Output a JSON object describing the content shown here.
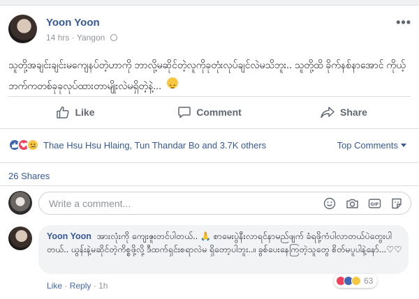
{
  "post": {
    "author": "Yoon Yoon",
    "time": "14 hrs",
    "location": "Yangon",
    "text": "သူတို့အချင်းချင်းမကျေနပ်တဲ့ဟာကို ဘာလို့မဆိုင်တဲ့လူကိုခုတုံးလုပ်ချင်လဲမသိဘူး.. သူတို့ထိ ခိုက်နစ်နာအောင် ကိုယ့်ဘက်ကတစ်ခုခုလုပ်ထားတာမျိုးလဲမရှိတဲ့နဲ့..."
  },
  "actions": {
    "like": "Like",
    "comment": "Comment",
    "share": "Share"
  },
  "reactions": {
    "names": "Thae Hsu Hsu Hlaing, Tun Thandar Bo and 3.7K others",
    "top_comments": "Top Comments"
  },
  "shares": "26 Shares",
  "composer": {
    "placeholder": "Write a comment..."
  },
  "comment": {
    "author": "Yoon Yoon",
    "text": "အားလုံးကို ကျေးဇူးတင်ပါတယ်.. 🙏 စာမေးပွဲနီးလာရင်နာမည်ဖျက် ခံရဖို့ကံပါလာတယ်ပဲတွေးပါတယ်.. ယွန်းနဲ့မဆိုင်တဲ့ကိစ္စဖို့လို့ ဒီထက်ရှင်းစရာလဲမ ရှိတော့ပါဘူး..။ ခွစ်ပေးနေကြတဲ့သူတွေ စိတ်မပူပါနဲ့နော်...♡♡",
    "like": "Like",
    "reply": "Reply",
    "time": "1h",
    "reaction_count": "63"
  },
  "colors": {
    "link": "#365899",
    "like_blue": "#4267b2",
    "love_red": "#f0425f",
    "sad_yellow": "#f7c742"
  }
}
